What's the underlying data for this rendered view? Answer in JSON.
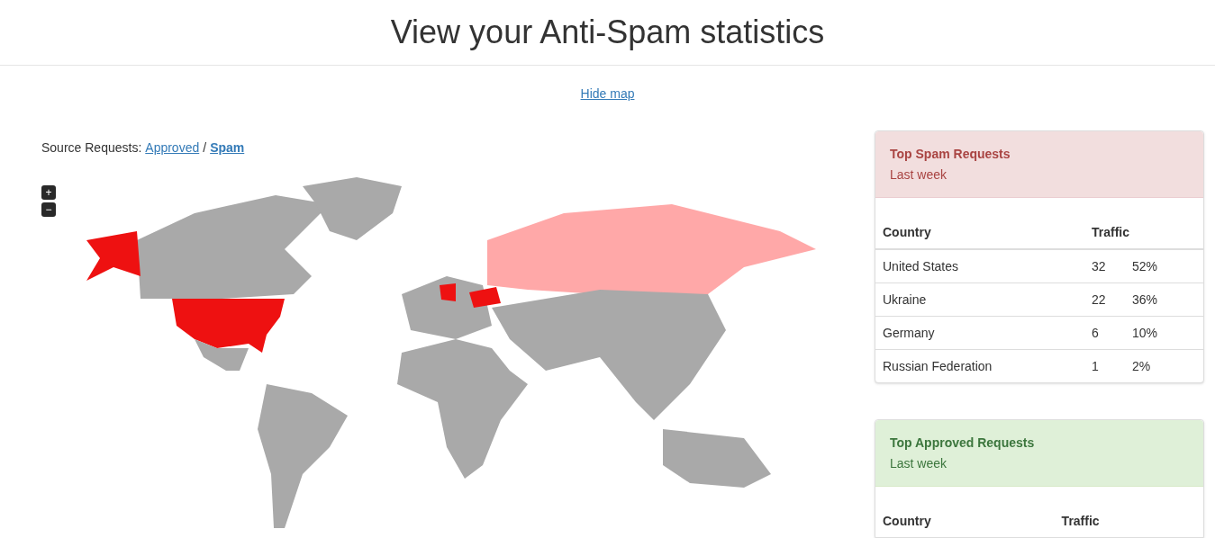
{
  "title": "View your Anti-Spam statistics",
  "hide_map_link": "Hide map",
  "source": {
    "label": "Source Requests:",
    "separator": "/",
    "options": [
      {
        "label": "Approved",
        "selected": false
      },
      {
        "label": "Spam",
        "selected": true
      }
    ]
  },
  "zoom_buttons": [
    "+",
    "−"
  ],
  "panels": [
    {
      "kind": "danger",
      "title": "Top Spam Requests",
      "subtitle": "Last week",
      "columns": [
        "Country",
        "Traffic"
      ],
      "rows": [
        {
          "country": "United States",
          "count": "32",
          "share": "52%"
        },
        {
          "country": "Ukraine",
          "count": "22",
          "share": "36%"
        },
        {
          "country": "Germany",
          "count": "6",
          "share": "10%"
        },
        {
          "country": "Russian Federation",
          "count": "1",
          "share": "2%"
        }
      ]
    },
    {
      "kind": "success",
      "title": "Top Approved Requests",
      "subtitle": "Last week",
      "columns": [
        "Country",
        "Traffic"
      ]
    }
  ]
}
